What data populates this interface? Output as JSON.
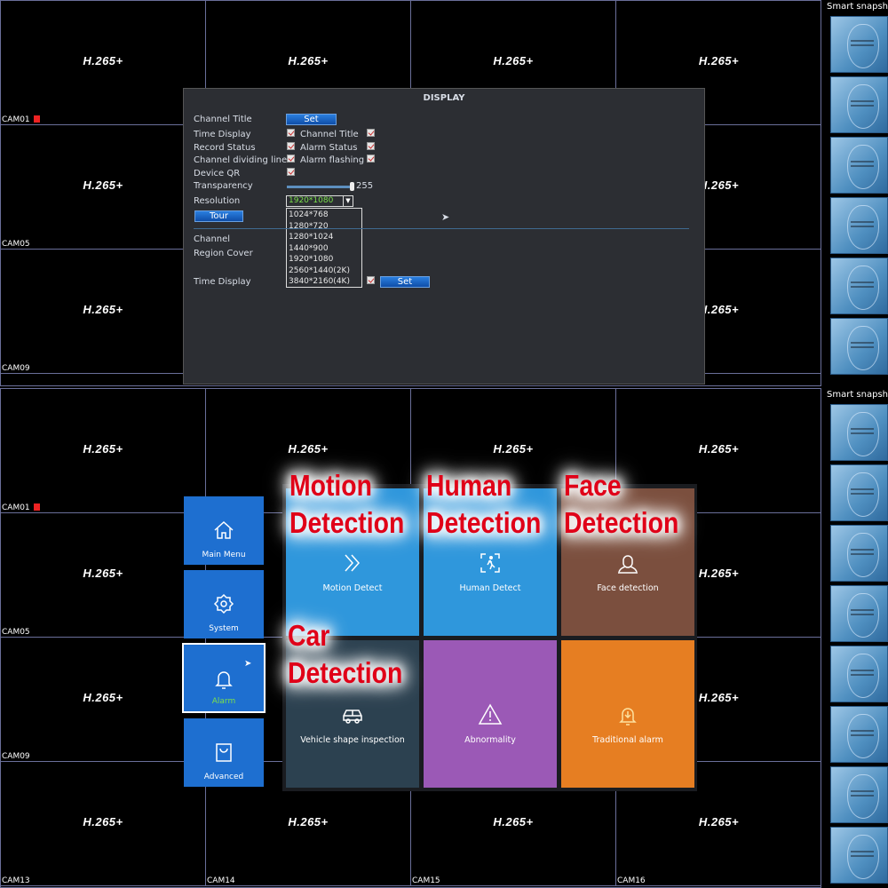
{
  "codec": "H.265+",
  "top_cams": [
    "CAM01",
    "",
    "",
    "",
    "CAM05",
    "",
    "",
    "",
    "CAM09",
    "",
    "",
    ""
  ],
  "bottom_cams": [
    "CAM01",
    "",
    "",
    "",
    "CAM05",
    "",
    "",
    "",
    "CAM09",
    "",
    "",
    "",
    "CAM13",
    "CAM14",
    "CAM15",
    "CAM16"
  ],
  "smart_snapshot_label": "Smart snapshot",
  "display": {
    "title": "DISPLAY",
    "channel_title": "Channel Title",
    "set": "Set",
    "time_display": "Time Display",
    "channel_title2": "Channel Title",
    "record_status": "Record Status",
    "alarm_status": "Alarm Status",
    "channel_dividing_line": "Channel dividing line",
    "alarm_flashing": "Alarm flashing",
    "device_qr": "Device QR",
    "transparency": "Transparency",
    "transparency_value": "255",
    "transparency_fraction": 1.0,
    "resolution": "Resolution",
    "resolution_value": "1920*1080",
    "resolution_options": [
      "1024*768",
      "1280*720",
      "1280*1024",
      "1440*900",
      "1920*1080",
      "2560*1440(2K)",
      "3840*2160(4K)"
    ],
    "tour": "Tour",
    "channel": "Channel",
    "region_cover": "Region Cover",
    "time_display2": "Time Display",
    "set2": "Set"
  },
  "menu": {
    "side": [
      {
        "label": "Main Menu",
        "icon": "home-icon"
      },
      {
        "label": "System",
        "icon": "gear-icon"
      },
      {
        "label": "Alarm",
        "icon": "bell-icon",
        "selected": true
      },
      {
        "label": "Advanced",
        "icon": "bag-icon"
      }
    ],
    "tiles": [
      {
        "label": "Motion Detect",
        "icon": "chevrons-icon",
        "color": "#2f97dc"
      },
      {
        "label": "Human Detect",
        "icon": "person-scan-icon",
        "color": "#2f97dc"
      },
      {
        "label": "Face detection",
        "icon": "face-icon",
        "color": "#7b4f3e"
      },
      {
        "label": "Vehicle shape inspection",
        "icon": "car-icon",
        "color": "#2c4150"
      },
      {
        "label": "Abnormality",
        "icon": "warning-icon",
        "color": "#9b59b6"
      },
      {
        "label": "Traditional alarm",
        "icon": "alarm-bell-icon",
        "color": "#e67e22"
      }
    ]
  },
  "overlays": {
    "motion": "Motion\nDetection",
    "human": "Human\nDetection",
    "face": "Face\nDetection",
    "car": "Car\nDetection"
  },
  "overlay_lines": {
    "motion_1": "Motion",
    "motion_2": "Detection",
    "human_1": "Human",
    "human_2": "Detection",
    "face_1": "Face",
    "face_2": "Detection",
    "car_1": "Car",
    "car_2": "Detection"
  }
}
